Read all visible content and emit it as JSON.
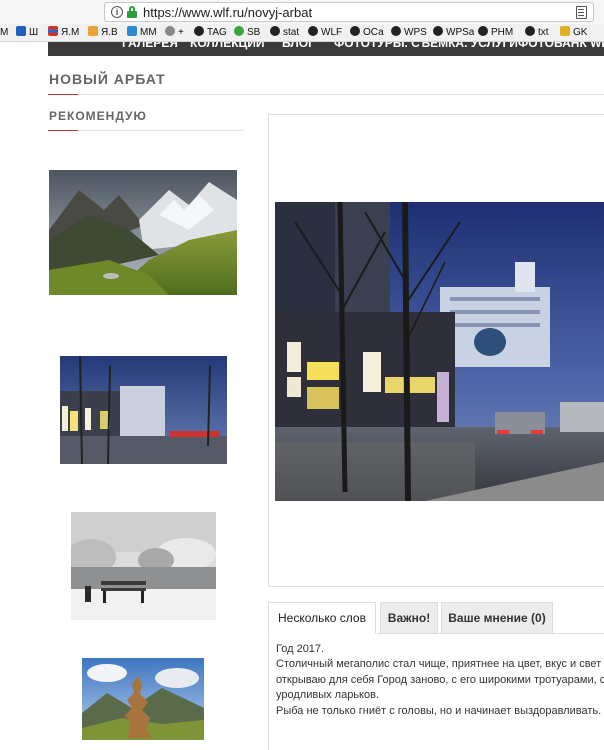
{
  "browser": {
    "url": "https://www.wlf.ru/novyj-arbat",
    "bookmarks": [
      {
        "label": "М",
        "color": "#ffffff"
      },
      {
        "label": "Ш",
        "color": "#1f5fbf"
      },
      {
        "label": "Я.М",
        "color": "#d9302b"
      },
      {
        "label": "Я.В",
        "color": "#e8a33b"
      },
      {
        "label": "MM",
        "color": "#2a8bd4"
      },
      {
        "label": "+",
        "color": "#888888"
      },
      {
        "label": "TAG",
        "color": "#222222"
      },
      {
        "label": "SB",
        "color": "#3aa63a"
      },
      {
        "label": "stat",
        "color": "#222222"
      },
      {
        "label": "WLF",
        "color": "#222222"
      },
      {
        "label": "ОСа",
        "color": "#222222"
      },
      {
        "label": "WPS",
        "color": "#222222"
      },
      {
        "label": "WPSa",
        "color": "#222222"
      },
      {
        "label": "PHM",
        "color": "#222222"
      },
      {
        "label": "txt",
        "color": "#222222"
      },
      {
        "label": "GK",
        "color": "#e0b020"
      }
    ]
  },
  "nav": {
    "items": [
      "ГАЛЕРЕЯ",
      "КОЛЛЕКЦИИ",
      "БЛОГ",
      "ФОТОТУРЫ. СЪЕМКА. УСЛУГИ",
      "ФОТОБАНК WLF"
    ]
  },
  "page": {
    "title": "НОВЫЙ АРБАТ"
  },
  "sidebar": {
    "title": "РЕКОМЕНДУЮ"
  },
  "tabs": [
    {
      "label": "Несколько слов",
      "active": true
    },
    {
      "label": "Важно!",
      "active": false
    },
    {
      "label": "Ваше мнение (0)",
      "active": false
    }
  ],
  "description": {
    "lines": [
      "Год 2017.",
      "Столичный мегаполис стал чище, приятнее на цвет, вкус и свет",
      "открываю для себя Город заново, с его широкими тротуарами, с",
      "уродливых ларьков.",
      "Рыба не только гниёт с головы, но и начинает выздоравливать."
    ]
  },
  "colors": {
    "accent": "#c0392b",
    "nav_bg": "#3a3a3a",
    "secure": "#2e9e3b"
  }
}
